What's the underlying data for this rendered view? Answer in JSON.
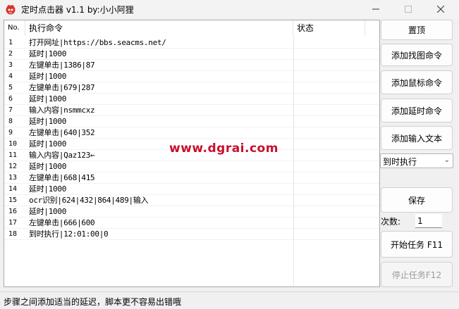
{
  "window": {
    "title": "定时点击器 v1.1 by:小小阿狸",
    "controls": {
      "minimize": "—",
      "maximize": "☐",
      "close": "✕"
    }
  },
  "list": {
    "headers": {
      "no": "No.",
      "command": "执行命令",
      "status": "状态"
    },
    "rows": [
      {
        "no": "1",
        "command": "打开网址|https://bbs.seacms.net/",
        "status": ""
      },
      {
        "no": "2",
        "command": "延时|1000",
        "status": ""
      },
      {
        "no": "3",
        "command": "左键单击|1386|87",
        "status": ""
      },
      {
        "no": "4",
        "command": "延时|1000",
        "status": ""
      },
      {
        "no": "5",
        "command": "左键单击|679|287",
        "status": ""
      },
      {
        "no": "6",
        "command": "延时|1000",
        "status": ""
      },
      {
        "no": "7",
        "command": "输入内容|nsmmcxz",
        "status": ""
      },
      {
        "no": "8",
        "command": "延时|1000",
        "status": ""
      },
      {
        "no": "9",
        "command": "左键单击|640|352",
        "status": ""
      },
      {
        "no": "10",
        "command": "延时|1000",
        "status": ""
      },
      {
        "no": "11",
        "command": "输入内容|Qaz123←",
        "status": ""
      },
      {
        "no": "12",
        "command": "延时|1000",
        "status": ""
      },
      {
        "no": "13",
        "command": "左键单击|668|415",
        "status": ""
      },
      {
        "no": "14",
        "command": "延时|1000",
        "status": ""
      },
      {
        "no": "15",
        "command": "ocr识别|624|432|864|489|输入",
        "status": ""
      },
      {
        "no": "16",
        "command": "延时|1000",
        "status": ""
      },
      {
        "no": "17",
        "command": "左键单击|666|600",
        "status": ""
      },
      {
        "no": "18",
        "command": "到时执行|12:01:00|0",
        "status": ""
      }
    ]
  },
  "watermark": "www.dgrai.com",
  "buttons": {
    "pin_top": "置顶",
    "add_find_image": "添加找图命令",
    "add_mouse": "添加鼠标命令",
    "add_delay": "添加延时命令",
    "add_input_text": "添加输入文本",
    "save": "保存",
    "start_task": "开始任务 F11",
    "stop_task": "停止任务F12"
  },
  "select": {
    "value": "到时执行"
  },
  "count": {
    "label": "次数:",
    "value": "1"
  },
  "statusbar": {
    "text": "步骤之间添加适当的延迟，脚本更不容易出错哦"
  },
  "colors": {
    "watermark": "#c8102e",
    "app_icon": "#d9342b"
  }
}
